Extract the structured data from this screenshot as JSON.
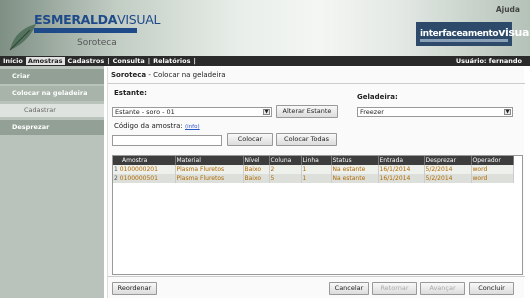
{
  "header": {
    "logo_primary": "ESMERALDA",
    "logo_secondary": "VISUAL",
    "site_name": "Soroteca",
    "help_label": "Ajuda",
    "brand_right_a": "interfaceamento",
    "brand_right_b": "visual"
  },
  "nav": {
    "items": [
      "Início",
      "Amostras",
      "Cadastros",
      "|",
      "Consulta",
      "|",
      "Relatórios",
      "|"
    ],
    "user_label": "Usuário: fernando"
  },
  "sidebar": {
    "items": [
      {
        "label": "Criar"
      },
      {
        "label": "Colocar na geladeira"
      },
      {
        "label": "Cadastrar"
      },
      {
        "label": "Desprezar"
      }
    ]
  },
  "main": {
    "breadcrumb_section": "Soroteca",
    "breadcrumb_page": " - Colocar na geladeira",
    "estante_label": "Estante:",
    "estante_value": "Estante - soro - 01",
    "alterar_estante_label": "Alterar Estante",
    "geladeira_label": "Geladeira:",
    "geladeira_value": "Freezer",
    "codigo_label": "Código da amostra:",
    "codigo_link": "(info)",
    "codigo_value": "",
    "colocar_label": "Colocar",
    "colocar_todas_label": "Colocar Todas"
  },
  "table": {
    "columns": [
      "Amostra",
      "Material",
      "Nível",
      "Coluna",
      "Linha",
      "Status",
      "Entrada",
      "Desprezar",
      "Operador"
    ],
    "rows": [
      {
        "num": "1",
        "cells": [
          "0100000201",
          "Plasma Fluretos",
          "Baixo",
          "2",
          "1",
          "Na estante",
          "16/1/2014",
          "5/2/2014",
          "word"
        ]
      },
      {
        "num": "2",
        "cells": [
          "0100000501",
          "Plasma Fluretos",
          "Baixo",
          "5",
          "1",
          "Na estante",
          "16/1/2014",
          "5/2/2014",
          "word"
        ]
      }
    ]
  },
  "footer": {
    "reordenar_label": "Reordenar",
    "cancelar_label": "Cancelar",
    "retornar_label": "Retornar",
    "avancar_label": "Avançar",
    "concluir_label": "Concluir"
  }
}
